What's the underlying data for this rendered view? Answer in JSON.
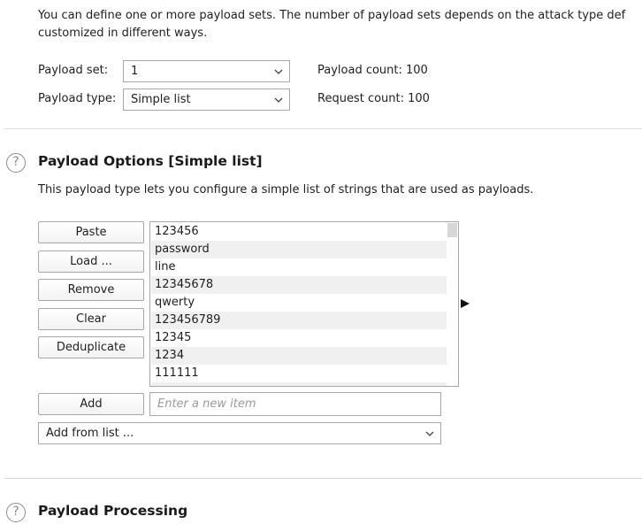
{
  "intro": {
    "line1": "You can define one or more payload sets. The number of payload sets depends on the attack type def",
    "line2": "customized in different ways."
  },
  "payload_sets": {
    "set_label": "Payload set:",
    "set_value": "1",
    "type_label": "Payload type:",
    "type_value": "Simple list",
    "payload_count": "Payload count: 100",
    "request_count": "Request count: 100"
  },
  "options_section": {
    "help": "?",
    "title": "Payload Options [Simple list]",
    "description": "This payload type lets you configure a simple list of strings that are used as payloads.",
    "buttons": {
      "paste": "Paste",
      "load": "Load ...",
      "remove": "Remove",
      "clear": "Clear",
      "deduplicate": "Deduplicate",
      "add": "Add"
    },
    "list_items": [
      "123456",
      "password",
      "line",
      "12345678",
      "qwerty",
      "123456789",
      "12345",
      "1234",
      "111111"
    ],
    "new_item_placeholder": "Enter a new item",
    "add_from_list": "Add from list ..."
  },
  "processing_section": {
    "help": "?",
    "title": "Payload Processing"
  },
  "colors": {
    "row_alt": "#f0f0f0",
    "border": "#a9a9a9",
    "help_icon": "#8c8c8c"
  }
}
